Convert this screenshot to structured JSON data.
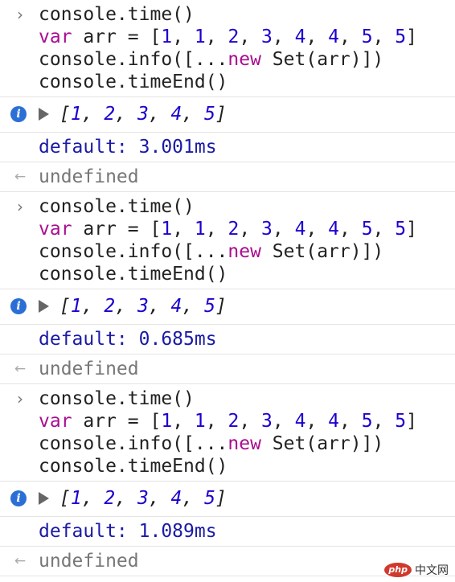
{
  "entries": [
    {
      "code": {
        "line1": "console.time()",
        "line2_kw": "var",
        "line2_rest": " arr = [",
        "line2_nums": [
          "1",
          "1",
          "2",
          "3",
          "4",
          "4",
          "5",
          "5"
        ],
        "line3_pre": "console.info([...",
        "line3_kw": "new",
        "line3_post": " Set(arr)])",
        "line4": "console.timeEnd()"
      },
      "output_array": [
        "1",
        "2",
        "3",
        "4",
        "5"
      ],
      "timer_label": "default: ",
      "timer_value": "3.001ms",
      "result": "undefined"
    },
    {
      "code": {
        "line1": "console.time()",
        "line2_kw": "var",
        "line2_rest": " arr = [",
        "line2_nums": [
          "1",
          "1",
          "2",
          "3",
          "4",
          "4",
          "5",
          "5"
        ],
        "line3_pre": "console.info([...",
        "line3_kw": "new",
        "line3_post": " Set(arr)])",
        "line4": "console.timeEnd()"
      },
      "output_array": [
        "1",
        "2",
        "3",
        "4",
        "5"
      ],
      "timer_label": "default: ",
      "timer_value": "0.685ms",
      "result": "undefined"
    },
    {
      "code": {
        "line1": "console.time()",
        "line2_kw": "var",
        "line2_rest": " arr = [",
        "line2_nums": [
          "1",
          "1",
          "2",
          "3",
          "4",
          "4",
          "5",
          "5"
        ],
        "line3_pre": "console.info([...",
        "line3_kw": "new",
        "line3_post": " Set(arr)])",
        "line4": "console.timeEnd()"
      },
      "output_array": [
        "1",
        "2",
        "3",
        "4",
        "5"
      ],
      "timer_label": "default: ",
      "timer_value": "1.089ms",
      "result": "undefined"
    }
  ],
  "icons": {
    "prompt": "chevron-right-icon",
    "prompt_glyph": "›",
    "info": "info-icon",
    "info_glyph": "i",
    "result": "result-arrow-icon",
    "result_glyph": "←"
  },
  "watermark": {
    "logo": "php",
    "text": "中文网"
  },
  "colors": {
    "keyword": "#aa0d91",
    "number": "#1c00cf",
    "log_text": "#1a1aa6",
    "result_text": "#777777",
    "info_icon": "#2b6fd6"
  }
}
